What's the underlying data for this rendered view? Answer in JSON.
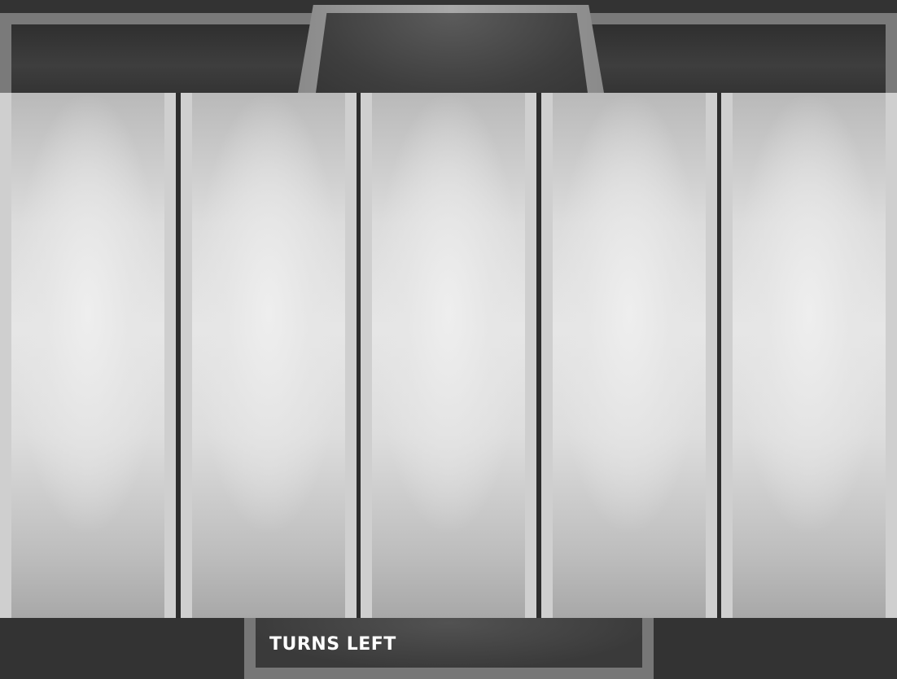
{
  "header": {
    "center_tab_label": ""
  },
  "reels": [
    {
      "id": 1,
      "symbol": ""
    },
    {
      "id": 2,
      "symbol": ""
    },
    {
      "id": 3,
      "symbol": ""
    },
    {
      "id": 4,
      "symbol": ""
    },
    {
      "id": 5,
      "symbol": ""
    }
  ],
  "footer": {
    "turns_left_label": "TURNS LEFT"
  },
  "colors": {
    "frame": "#7a7a7a",
    "panel_dark": "#333333",
    "reel_light": "#e6e6e6",
    "reel_divider": "#2d2d2d"
  }
}
